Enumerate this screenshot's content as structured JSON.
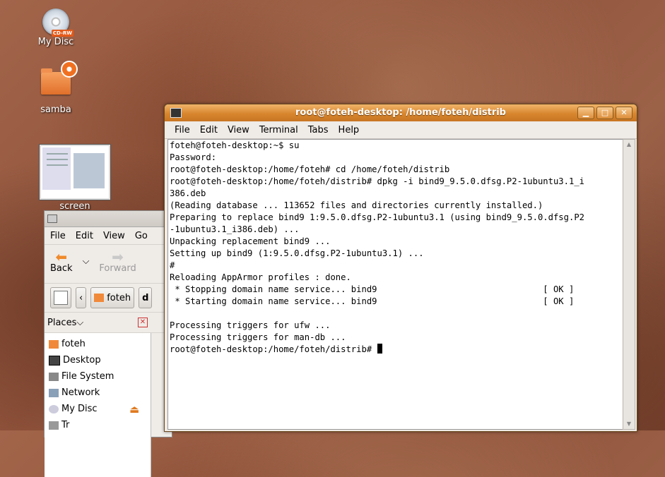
{
  "desktop": {
    "icons": [
      {
        "label": "My Disc",
        "badge": "CD-RW"
      },
      {
        "label": "samba"
      },
      {
        "label": "screen"
      }
    ]
  },
  "nautilus": {
    "menu": [
      "File",
      "Edit",
      "View",
      "Go"
    ],
    "toolbar": {
      "back": "Back",
      "forward": "Forward"
    },
    "location": {
      "crumb": "foteh",
      "next": "d"
    },
    "places_header": "Places",
    "places": [
      "foteh",
      "Desktop",
      "File System",
      "Network",
      "My Disc",
      "Tr"
    ]
  },
  "terminal": {
    "title": "root@foteh-desktop: /home/foteh/distrib",
    "menu": [
      "File",
      "Edit",
      "View",
      "Terminal",
      "Tabs",
      "Help"
    ],
    "lines": [
      "foteh@foteh-desktop:~$ su",
      "Password:",
      "root@foteh-desktop:/home/foteh# cd /home/foteh/distrib",
      "root@foteh-desktop:/home/foteh/distrib# dpkg -i bind9_9.5.0.dfsg.P2-1ubuntu3.1_i",
      "386.deb",
      "(Reading database ... 113652 files and directories currently installed.)",
      "Preparing to replace bind9 1:9.5.0.dfsg.P2-1ubuntu3.1 (using bind9_9.5.0.dfsg.P2",
      "-1ubuntu3.1_i386.deb) ...",
      "Unpacking replacement bind9 ...",
      "Setting up bind9 (1:9.5.0.dfsg.P2-1ubuntu3.1) ...",
      "#",
      "Reloading AppArmor profiles : done.",
      " * Stopping domain name service... bind9                                [ OK ]",
      " * Starting domain name service... bind9                                [ OK ]",
      "",
      "Processing triggers for ufw ...",
      "Processing triggers for man-db ...",
      "root@foteh-desktop:/home/foteh/distrib# "
    ]
  },
  "colors": {
    "title_bar": "#d8862e",
    "back_arrow": "#f08a2a"
  }
}
